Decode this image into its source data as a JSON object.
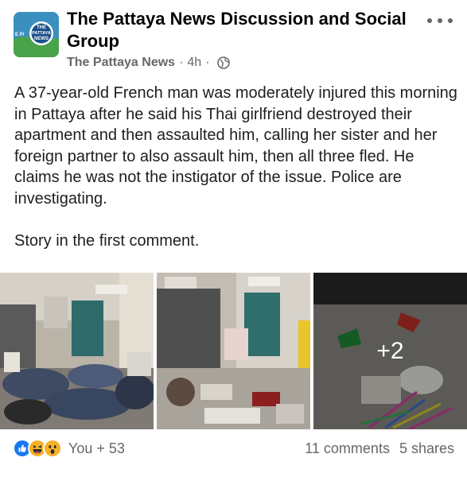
{
  "post": {
    "group_name": "The Pattaya News Discussion and Social Group",
    "author": "The Pattaya News",
    "time": "4h",
    "separator": "·",
    "avatar_text": {
      "top": "THE",
      "middle": "PATTAYA",
      "bottom": "NEWS",
      "side": "E P/"
    },
    "body_paragraphs": [
      "A 37-year-old French man was moderately injured this morning in Pattaya after he said his Thai girlfriend destroyed their apartment and then assaulted him, calling her sister and her foreign partner to also assault him, then all three fled. He claims he was not the instigator of the issue. Police are investigating.",
      "Story in the first comment."
    ],
    "photos": {
      "more_count": "+2"
    },
    "reactions": {
      "icons": [
        "like-icon",
        "haha-icon",
        "wow-icon"
      ],
      "summary": "You + 53"
    },
    "comments": "11 comments",
    "shares": "5 shares",
    "colors": {
      "like_blue": "#1877f2",
      "emoji_yellow": "#f7b125",
      "secondary_text": "#65676b"
    }
  }
}
